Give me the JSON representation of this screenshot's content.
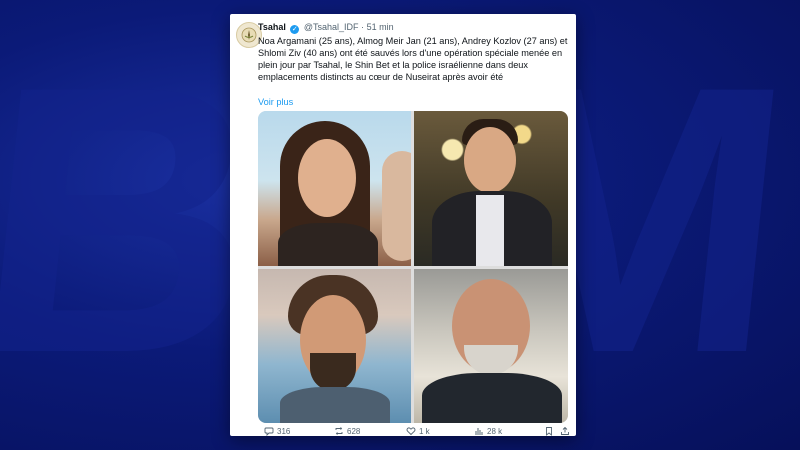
{
  "tweet": {
    "author_name": "Tsahal",
    "author_handle": "@Tsahal_IDF",
    "separator": "·",
    "time": "51 min",
    "text": "Noa Argamani (25 ans), Almog Meir Jan (21 ans), Andrey Kozlov (27 ans) et Shlomi Ziv (40 ans) ont été sauvés lors d'une opération spéciale menée en plein jour par Tsahal, le Shin Bet et la police israélienne dans deux emplacements distincts au cœur de Nuseirat après avoir été",
    "see_more": "Voir plus"
  },
  "actions": {
    "replies": "316",
    "reposts": "628",
    "likes": "1 k",
    "views": "28 k"
  },
  "background": {
    "letters": "BFM"
  },
  "colors": {
    "background": "#0a1a7a",
    "card": "#ffffff",
    "link": "#1d9bf0",
    "muted": "#536471"
  }
}
